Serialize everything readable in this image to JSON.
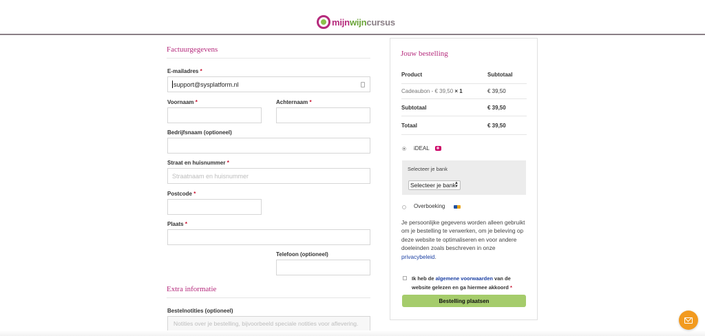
{
  "brand": {
    "part1": "mijn",
    "part2": "wijn",
    "part3": "cursus"
  },
  "billing": {
    "title": "Factuurgegevens",
    "email": {
      "label": "E-mailadres",
      "value": "support@sysplatform.nl"
    },
    "first_name": {
      "label": "Voornaam",
      "value": ""
    },
    "last_name": {
      "label": "Achternaam",
      "value": ""
    },
    "company": {
      "label": "Bedrijfsnaam (optioneel)",
      "value": ""
    },
    "street": {
      "label": "Straat en huisnummer",
      "placeholder": "Straatnaam en huisnummer"
    },
    "postcode": {
      "label": "Postcode",
      "value": ""
    },
    "city": {
      "label": "Plaats",
      "value": ""
    },
    "phone": {
      "label": "Telefoon (optioneel)",
      "value": ""
    },
    "required_mark": "*"
  },
  "extra": {
    "title": "Extra informatie",
    "notes": {
      "label": "Bestelnotities (optioneel)",
      "placeholder": "Notities over je bestelling, bijvoorbeeld speciale notities voor aflevering."
    }
  },
  "order": {
    "title": "Jouw bestelling",
    "col_product": "Product",
    "col_subtotal": "Subtotaal",
    "item_name": "Cadeaubon - € 39,50",
    "item_qty": "× 1",
    "item_price": "€ 39,50",
    "subtotal_label": "Subtotaal",
    "subtotal_value": "€ 39,50",
    "total_label": "Totaal",
    "total_value": "€ 39,50"
  },
  "payment": {
    "ideal_label": "iDEAL",
    "bank_label": "Selecteer je bank",
    "bank_selected": "Selecteer je bank",
    "transfer_label": "Overboeking",
    "selected_method": "iDEAL"
  },
  "privacy": {
    "text": "Je persoonlijke gegevens worden alleen gebruikt om je bestelling te verwerken, om je beleving op deze website te optimaliseren en voor andere doeleinden zoals beschreven in onze ",
    "link": "privacybeleid",
    "end": "."
  },
  "terms": {
    "pre": "Ik heb de ",
    "link": "algemene voorwaarden",
    "post": " van de website gelezen en ga hiermee akkoord ",
    "req": "*"
  },
  "place_order": "Bestelling plaatsen",
  "colors": {
    "accent": "#b52a7c",
    "button": "#a5cc6b",
    "fab": "#f29a1f",
    "link": "#1a3fa3"
  }
}
